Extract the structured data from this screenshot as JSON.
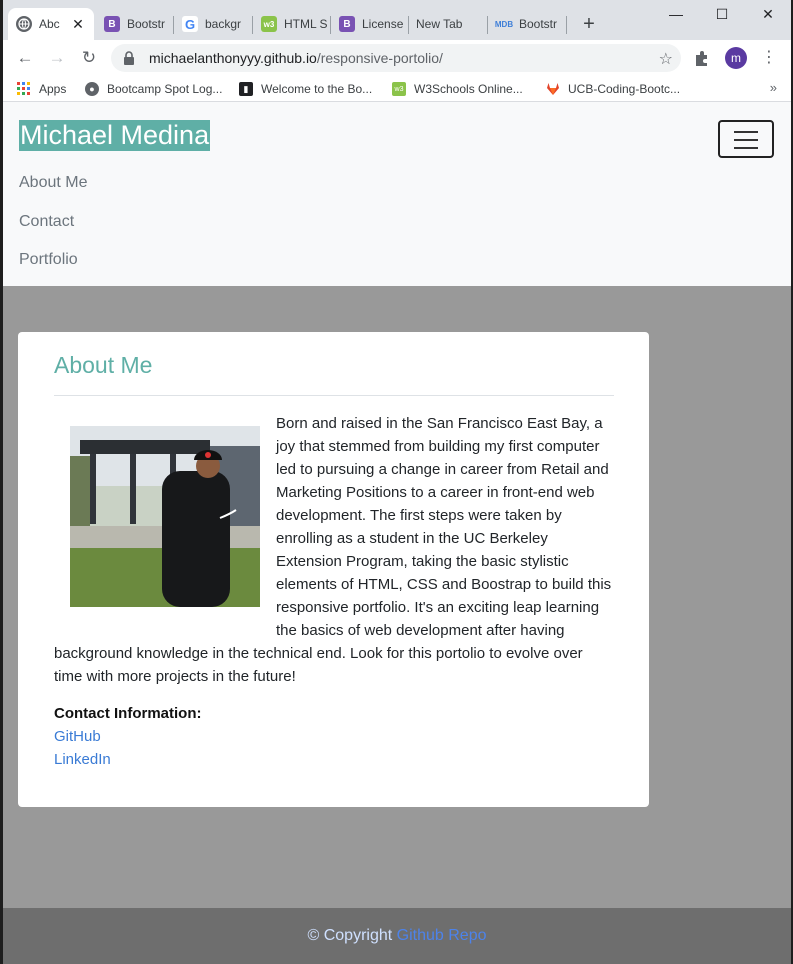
{
  "browser": {
    "tabs": [
      {
        "label": "Abc",
        "icon": "globe-icon",
        "active": true
      },
      {
        "label": "Bootstr",
        "icon": "bootstrap-icon"
      },
      {
        "label": "backgr",
        "icon": "google-icon"
      },
      {
        "label": "HTML S",
        "icon": "w3schools-icon"
      },
      {
        "label": "License",
        "icon": "bootstrap-icon"
      },
      {
        "label": "New Tab",
        "icon": ""
      },
      {
        "label": "Bootstr",
        "icon": "mdb-icon"
      }
    ],
    "url_host": "michaelanthonyyy.github.io",
    "url_path": "/responsive-portolio/",
    "profile_initial": "m",
    "bookmarks": [
      {
        "label": "Apps",
        "icon": "apps-grid-icon"
      },
      {
        "label": "Bootcamp Spot Log...",
        "icon": "globe-icon"
      },
      {
        "label": "Welcome to the Bo...",
        "icon": "book-icon"
      },
      {
        "label": "W3Schools Online...",
        "icon": "w3schools-icon"
      },
      {
        "label": "UCB-Coding-Bootc...",
        "icon": "gitlab-icon"
      }
    ],
    "more_bookmarks": "»"
  },
  "site": {
    "brand": "Michael Medina",
    "nav": [
      "About Me",
      "Contact",
      "Portfolio"
    ],
    "about_title": "About Me",
    "bio": "Born and raised in the San Francisco East Bay, a joy that stemmed from building my first computer led to pursuing a change in career from Retail and Marketing Positions to a career in front-end web development. The first steps were taken by enrolling as a student in the UC Berkeley Extension Program, taking the basic stylistic elements of HTML, CSS and Boostrap to build this responsive portfolio. It's an exciting leap learning the basics of web development after having background knowledge in the technical end. Look for this portolio to evolve over time with more projects in the future!",
    "contact_heading": "Contact Information:",
    "links": [
      "GitHub",
      "LinkedIn"
    ],
    "footer_text": "© Copyright",
    "footer_link": "Github Repo"
  },
  "colors": {
    "accent": "#5fafa6",
    "page_bg": "#999999",
    "link": "#3a7bd5"
  }
}
